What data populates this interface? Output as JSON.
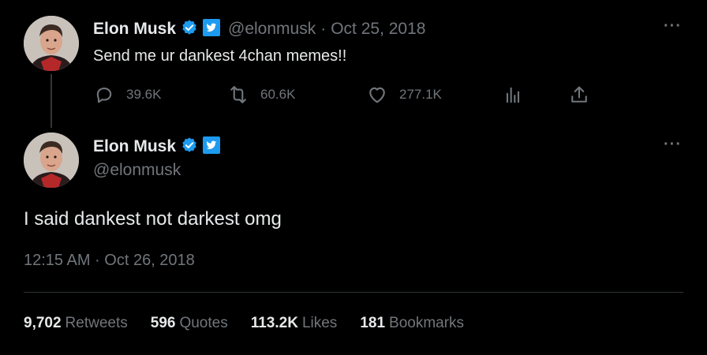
{
  "colors": {
    "background": "#000000",
    "text": "#e7e9ea",
    "muted": "#71767b",
    "verified": "#1d9bf0",
    "divider": "#2f3336"
  },
  "parent_tweet": {
    "author": {
      "name": "Elon Musk",
      "handle": "@elonmusk"
    },
    "separator": "·",
    "date": "Oct 25, 2018",
    "text": "Send me ur dankest 4chan memes!!",
    "more_label": "···",
    "metrics": {
      "replies": "39.6K",
      "retweets": "60.6K",
      "likes": "277.1K"
    },
    "icons": [
      "reply-icon",
      "retweet-icon",
      "like-icon",
      "views-icon",
      "share-icon"
    ]
  },
  "main_tweet": {
    "author": {
      "name": "Elon Musk",
      "handle": "@elonmusk"
    },
    "more_label": "···",
    "text": "I said dankest not darkest omg",
    "timestamp": "12:15 AM · Oct 26, 2018",
    "stats": [
      {
        "value": "9,702",
        "label": "Retweets"
      },
      {
        "value": "596",
        "label": "Quotes"
      },
      {
        "value": "113.2K",
        "label": "Likes"
      },
      {
        "value": "181",
        "label": "Bookmarks"
      }
    ]
  }
}
